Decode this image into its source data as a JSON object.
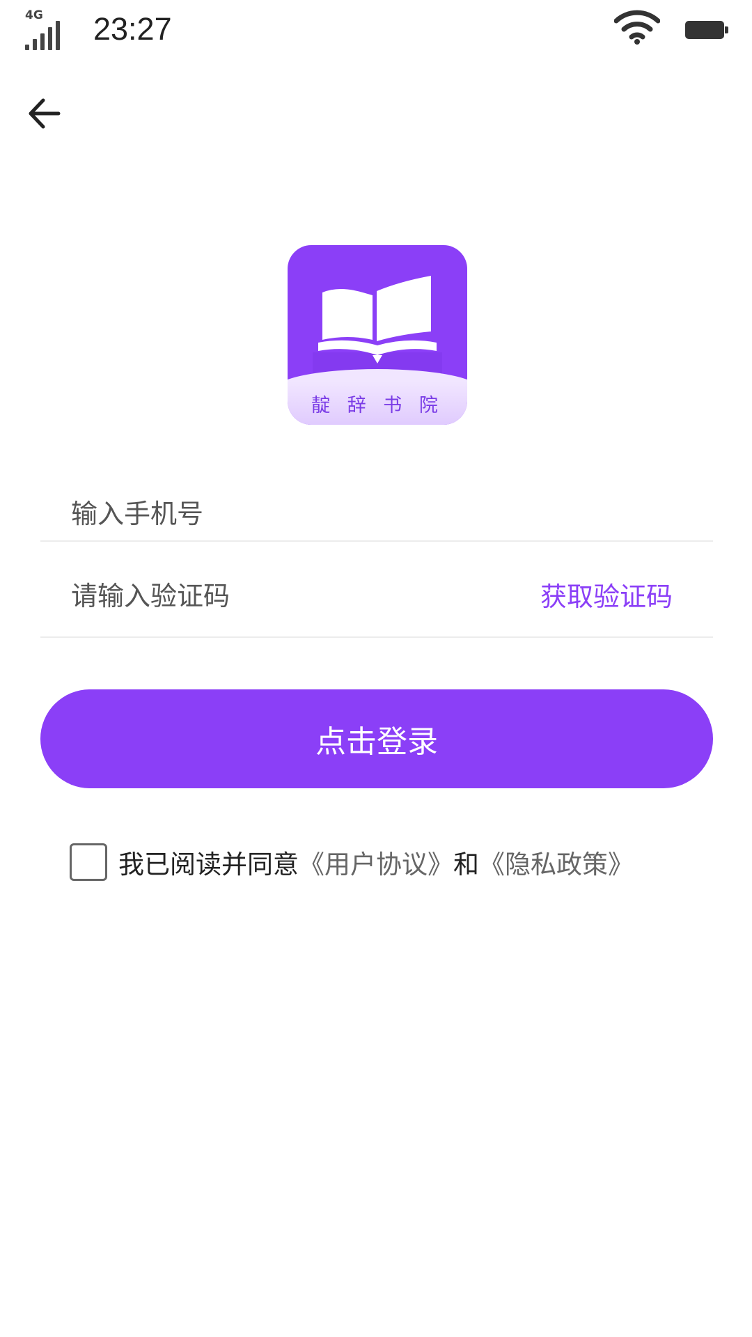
{
  "status_bar": {
    "network": "4G",
    "time": "23:27",
    "signal_icon": "cellular-signal-icon",
    "wifi_icon": "wifi-icon",
    "battery_icon": "battery-icon"
  },
  "nav": {
    "back_icon": "arrow-left-icon"
  },
  "logo": {
    "brand_text": "靛 辞 书 院",
    "icon": "open-book-icon",
    "color": "#8b3ff7"
  },
  "form": {
    "phone_placeholder": "输入手机号",
    "phone_value": "",
    "code_placeholder": "请输入验证码",
    "code_value": "",
    "get_code_label": "获取验证码",
    "login_label": "点击登录"
  },
  "agreement": {
    "checked": false,
    "prefix": "我已阅读并同意",
    "user_agreement": "《用户协议》",
    "conjunction": "和",
    "privacy_policy": "《隐私政策》"
  },
  "colors": {
    "accent": "#8b3ff7",
    "text": "#222222",
    "link": "#666666",
    "divider": "#ececec"
  }
}
